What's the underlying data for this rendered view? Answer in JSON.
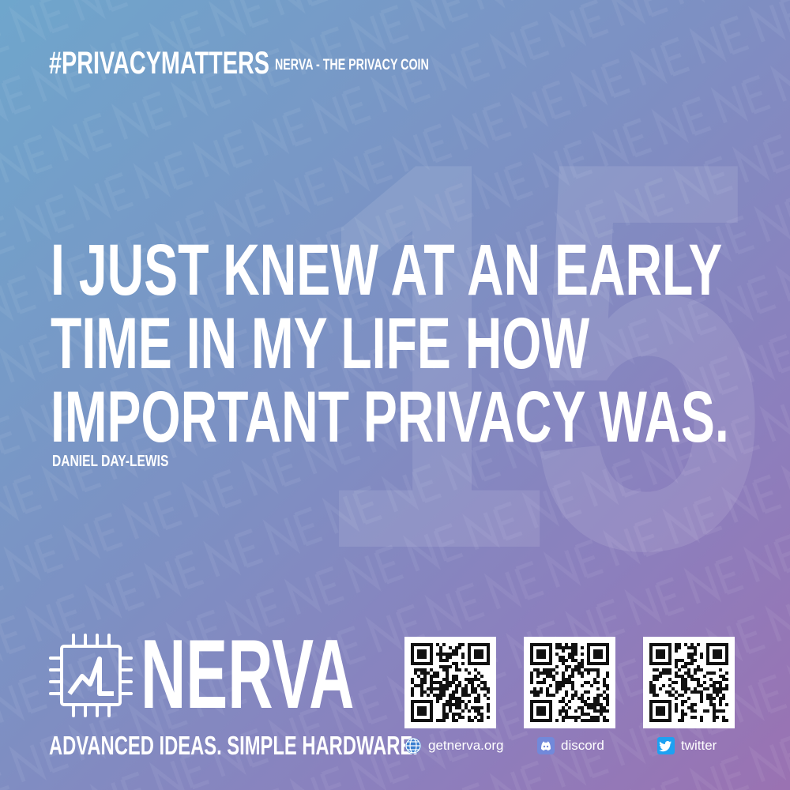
{
  "header": {
    "hashtag": "#PRIVACYMATTERS",
    "subtitle": "NERVA - THE PRIVACY COIN"
  },
  "background_number": "15",
  "quote": {
    "lines": [
      "I JUST KNEW AT AN EARLY",
      "TIME IN MY LIFE HOW",
      "IMPORTANT PRIVACY WAS."
    ],
    "author": "DANIEL DAY-LEWIS"
  },
  "brand": {
    "name": "NERVA",
    "slogan": "ADVANCED IDEAS. SIMPLE HARDWARE.",
    "logo_icon": "chip-logo-icon"
  },
  "links": [
    {
      "label": "getnerva.org",
      "icon": "globe-icon"
    },
    {
      "label": "discord",
      "icon": "discord-icon"
    },
    {
      "label": "twitter",
      "icon": "twitter-icon"
    }
  ],
  "colors": {
    "gradient_start": "#6fa6cc",
    "gradient_end": "#9a72b2",
    "text": "#ffffff",
    "discord": "#7289da",
    "twitter": "#1da1f2"
  }
}
